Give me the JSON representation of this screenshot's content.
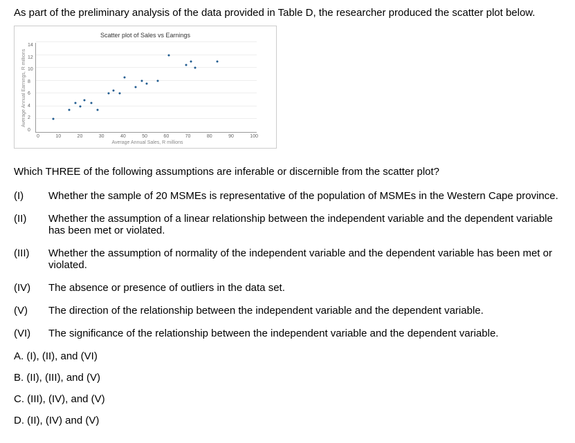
{
  "intro": "As part of the preliminary analysis of the data provided in Table D, the researcher produced the scatter plot below.",
  "question": "Which THREE of the following assumptions are inferable or discernible from the scatter plot?",
  "statements": [
    {
      "num": "(I)",
      "text": "Whether the sample of 20 MSMEs is representative of the population of MSMEs in the Western Cape province."
    },
    {
      "num": "(II)",
      "text": "Whether the assumption of a linear relationship between the independent variable and the dependent variable has been met or violated."
    },
    {
      "num": "(III)",
      "text": "Whether the assumption of normality of the independent variable and the dependent variable has been met or violated."
    },
    {
      "num": "(IV)",
      "text": "The absence or presence of outliers in the data set."
    },
    {
      "num": "(V)",
      "text": "The direction of the relationship between the independent variable and the dependent variable."
    },
    {
      "num": "(VI)",
      "text": "The significance of the relationship between the independent variable and the dependent variable."
    }
  ],
  "options": [
    "A. (I), (II), and (VI)",
    "B. (II), (III), and (V)",
    "C. (III), (IV), and (V)",
    "D. (II), (IV) and (V)"
  ],
  "chart_data": {
    "type": "scatter",
    "title": "Scatter plot of Sales vs Earnings",
    "xlabel": "Average Annual Sales, R millions",
    "ylabel": "Average Annual Earnings, R millions",
    "xlim": [
      0,
      100
    ],
    "ylim": [
      0,
      14
    ],
    "xticks": [
      0,
      10,
      20,
      30,
      40,
      50,
      60,
      70,
      80,
      90,
      100
    ],
    "yticks": [
      0,
      2,
      4,
      6,
      8,
      10,
      12,
      14
    ],
    "points": [
      {
        "x": 8,
        "y": 2
      },
      {
        "x": 15,
        "y": 3.5
      },
      {
        "x": 18,
        "y": 4.5
      },
      {
        "x": 20,
        "y": 4
      },
      {
        "x": 22,
        "y": 5
      },
      {
        "x": 25,
        "y": 4.5
      },
      {
        "x": 28,
        "y": 3.5
      },
      {
        "x": 33,
        "y": 6
      },
      {
        "x": 35,
        "y": 6.5
      },
      {
        "x": 38,
        "y": 6
      },
      {
        "x": 40,
        "y": 8.5
      },
      {
        "x": 45,
        "y": 7
      },
      {
        "x": 48,
        "y": 8
      },
      {
        "x": 50,
        "y": 7.5
      },
      {
        "x": 55,
        "y": 8
      },
      {
        "x": 60,
        "y": 12
      },
      {
        "x": 68,
        "y": 10.5
      },
      {
        "x": 70,
        "y": 11
      },
      {
        "x": 72,
        "y": 10
      },
      {
        "x": 82,
        "y": 11
      }
    ]
  }
}
